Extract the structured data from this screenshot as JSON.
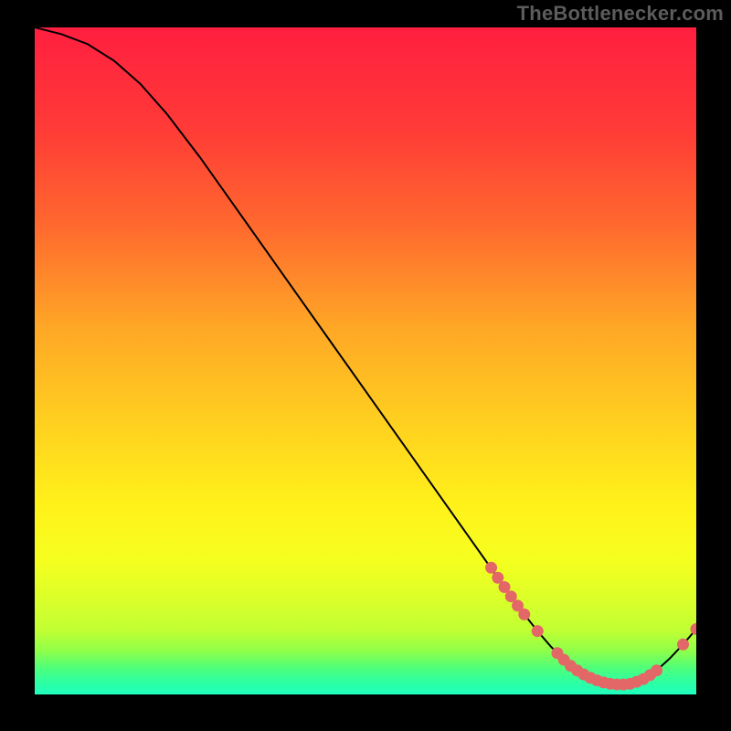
{
  "watermark": "TheBottlenecker.com",
  "chart_data": {
    "type": "line",
    "title": "",
    "xlabel": "",
    "ylabel": "",
    "xlim": [
      0,
      100
    ],
    "ylim": [
      0,
      100
    ],
    "grid": false,
    "x": [
      0,
      4,
      8,
      12,
      16,
      20,
      25,
      30,
      35,
      40,
      45,
      50,
      55,
      60,
      65,
      70,
      72,
      74,
      76,
      78,
      80,
      82,
      84,
      86,
      88,
      90,
      92,
      94,
      96,
      98,
      100
    ],
    "values": [
      100,
      99,
      97.5,
      95,
      91.5,
      87,
      80.5,
      73.5,
      66.5,
      59.5,
      52.5,
      45.5,
      38.5,
      31.5,
      24.5,
      17.5,
      14.7,
      12,
      9.5,
      7.2,
      5.2,
      3.6,
      2.5,
      1.8,
      1.5,
      1.6,
      2.3,
      3.6,
      5.4,
      7.5,
      9.8
    ],
    "markers_x": [
      69,
      70,
      71,
      72,
      73,
      74,
      76,
      79,
      80,
      81,
      82,
      83,
      84,
      85,
      86,
      87,
      88,
      89,
      90,
      91,
      92,
      93,
      94,
      98,
      100
    ],
    "markers_y": [
      19,
      17.5,
      16.1,
      14.7,
      13.3,
      12,
      9.5,
      6.2,
      5.2,
      4.3,
      3.6,
      3.0,
      2.5,
      2.1,
      1.8,
      1.6,
      1.5,
      1.5,
      1.6,
      1.9,
      2.3,
      2.9,
      3.6,
      7.5,
      9.8
    ],
    "gradient_stops": [
      {
        "offset": 0.0,
        "color": "#ff1f40"
      },
      {
        "offset": 0.15,
        "color": "#ff3a37"
      },
      {
        "offset": 0.3,
        "color": "#ff6a2e"
      },
      {
        "offset": 0.45,
        "color": "#ffa726"
      },
      {
        "offset": 0.6,
        "color": "#ffd21f"
      },
      {
        "offset": 0.72,
        "color": "#fff21a"
      },
      {
        "offset": 0.8,
        "color": "#f5ff1f"
      },
      {
        "offset": 0.86,
        "color": "#d9ff2a"
      },
      {
        "offset": 0.905,
        "color": "#c0ff33"
      },
      {
        "offset": 0.935,
        "color": "#8eff4a"
      },
      {
        "offset": 0.96,
        "color": "#4fff7a"
      },
      {
        "offset": 0.98,
        "color": "#2fffa0"
      },
      {
        "offset": 1.0,
        "color": "#1fffc0"
      }
    ],
    "marker_color": "#e46767",
    "line_color": "#000000"
  }
}
